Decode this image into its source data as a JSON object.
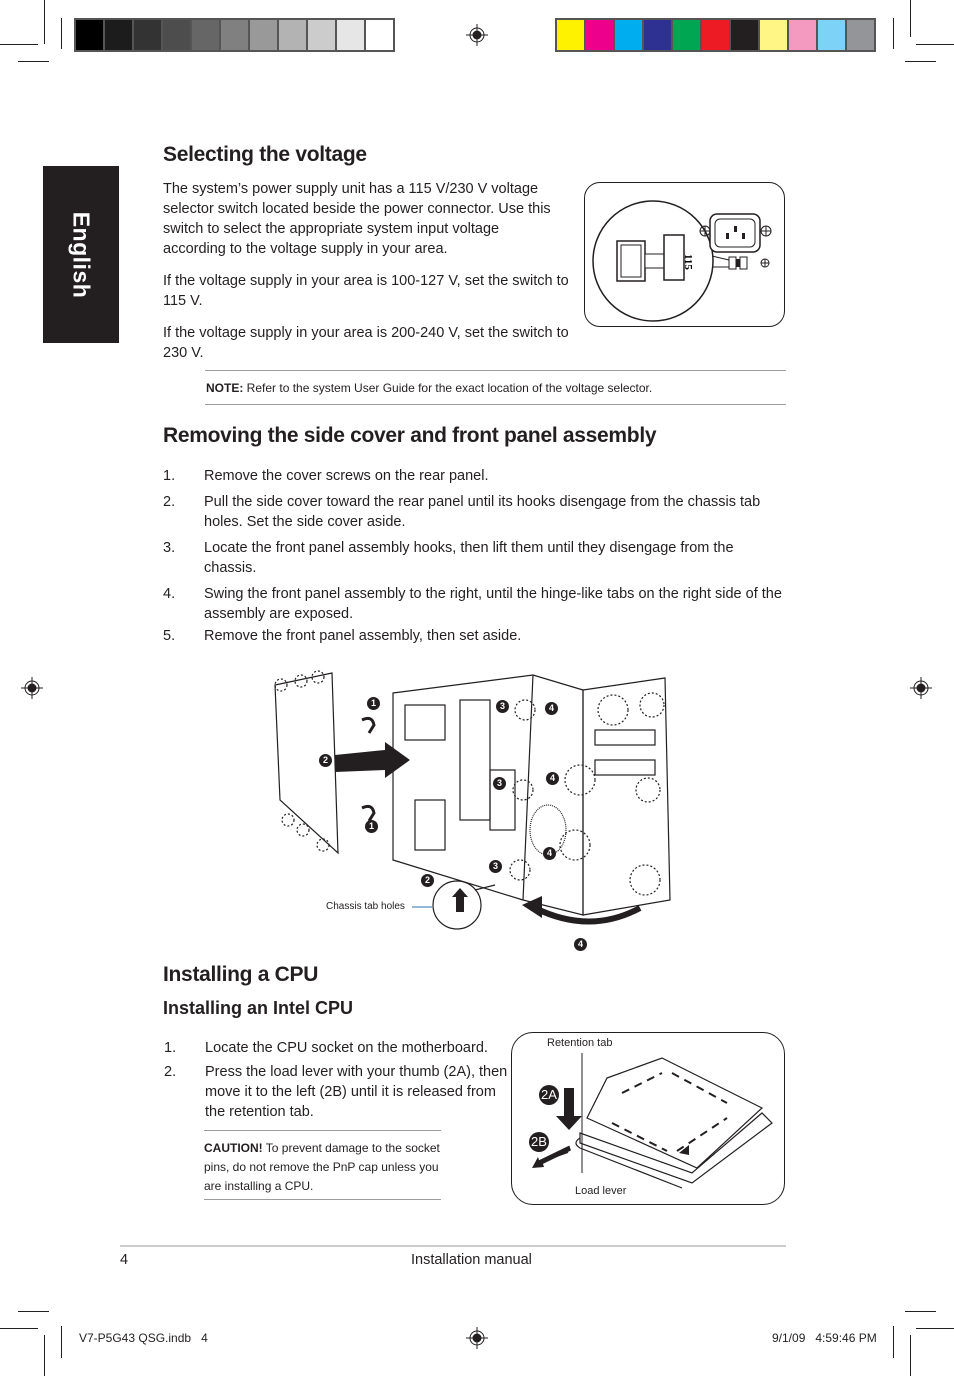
{
  "print_marks": {
    "gray_swatches": [
      "#000000",
      "#1c1c1c",
      "#333333",
      "#4d4d4d",
      "#666666",
      "#808080",
      "#999999",
      "#b3b3b3",
      "#cccccc",
      "#e6e6e6",
      "#ffffff"
    ],
    "color_swatches": [
      "#fff200",
      "#ec008c",
      "#00aeef",
      "#2e3192",
      "#00a651",
      "#ed1c24",
      "#231f20",
      "#fff685",
      "#f49ac1",
      "#7dd3f7",
      "#939598"
    ]
  },
  "language_tab": "English",
  "voltage_section": {
    "title": "Selecting the voltage",
    "paragraphs": [
      "The system’s power supply unit has a 115 V/230 V voltage selector switch located beside the power connector. Use this switch to select the appropriate system input voltage according to the voltage supply in your area.",
      "If the voltage supply in your area is 100-127 V, set the switch to 115 V.",
      "If the voltage supply in your area is 200-240 V, set the switch to 230 V."
    ],
    "figure_switch_label": "115",
    "note_label": "NOTE:",
    "note_text": " Refer to the system User Guide for the exact location of the voltage selector."
  },
  "cover_section": {
    "title": "Removing the side cover and front panel assembly",
    "steps": [
      {
        "num": "1.",
        "text": "Remove the cover screws on the rear panel."
      },
      {
        "num": "2.",
        "text": "Pull the side cover toward the rear panel until its hooks disengage from the chassis tab holes. Set the side cover aside."
      },
      {
        "num": "3.",
        "text": "Locate the front panel assembly hooks, then lift them until they disengage from the chassis."
      },
      {
        "num": "4.",
        "text": "Swing the front panel assembly to the right, until the hinge-like tabs on the right side of the assembly are exposed."
      },
      {
        "num": "5.",
        "text": "Remove the front panel assembly, then set aside."
      }
    ],
    "figure": {
      "callout_chassis": "Chassis tab holes",
      "markers": [
        "1",
        "1",
        "2",
        "2",
        "3",
        "3",
        "3",
        "4",
        "4",
        "4",
        "4"
      ]
    }
  },
  "cpu_section": {
    "title": "Installing a CPU",
    "subtitle": "Installing an Intel CPU",
    "steps": [
      {
        "num": "1.",
        "text": "Locate the CPU socket on the motherboard."
      },
      {
        "num": "2.",
        "text": "Press the load lever with your thumb (2A), then move it to the left (2B) until it is released from the retention tab."
      }
    ],
    "caution_label": "CAUTION!",
    "caution_text": " To prevent damage to the socket pins, do not remove the PnP cap unless you are installing a CPU.",
    "figure": {
      "label_retention": "Retention tab",
      "label_lever": "Load lever",
      "marker_2a": "2A",
      "marker_2b": "2B"
    }
  },
  "footer": {
    "page_number": "4",
    "doc_title": "Installation manual",
    "slug_file": "V7-P5G43 QSG.indb   4",
    "slug_date": "9/1/09   4:59:46 PM"
  }
}
